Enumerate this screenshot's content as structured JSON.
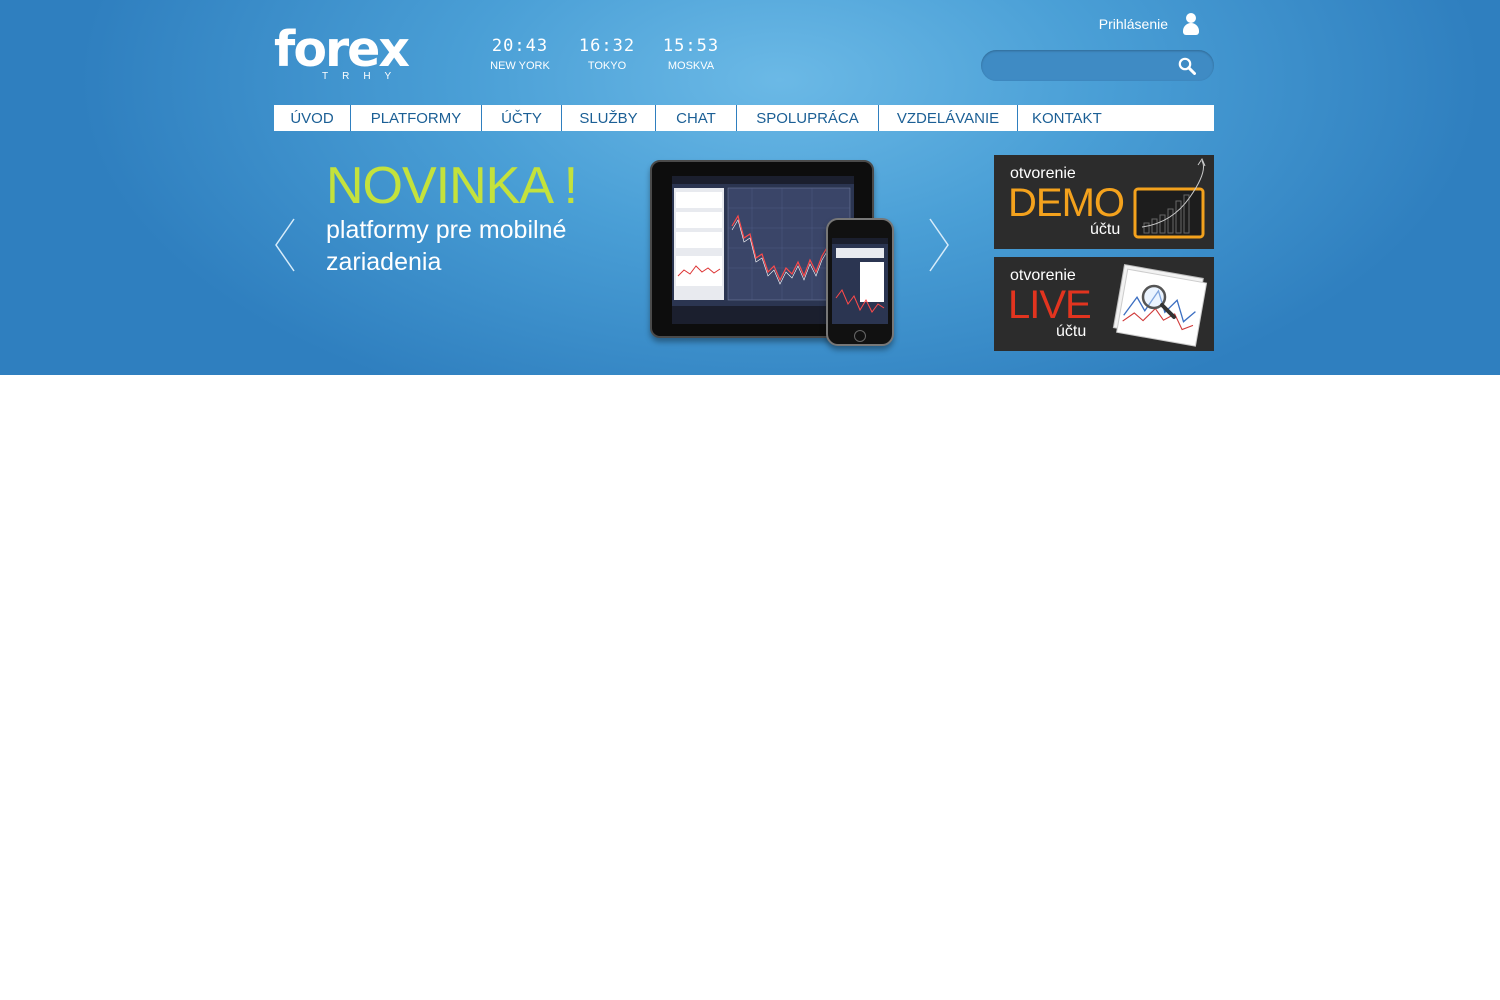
{
  "logo": {
    "word": "forex",
    "sub": "TRHY"
  },
  "clocks": [
    {
      "time": "20:43",
      "city": "NEW YORK"
    },
    {
      "time": "16:32",
      "city": "TOKYO"
    },
    {
      "time": "15:53",
      "city": "MOSKVA"
    }
  ],
  "login": {
    "label": "Prihlásenie",
    "icon": "user-icon"
  },
  "search": {
    "placeholder": "",
    "icon": "search-icon"
  },
  "nav": {
    "items": [
      {
        "label": "ÚVOD"
      },
      {
        "label": "PLATFORMY"
      },
      {
        "label": "ÚČTY"
      },
      {
        "label": "SLUŽBY"
      },
      {
        "label": "CHAT"
      },
      {
        "label": "SPOLUPRÁCA"
      },
      {
        "label": "VZDELÁVANIE"
      },
      {
        "label": "KONTAKT"
      }
    ]
  },
  "slider": {
    "title": "NOVINKA !",
    "text": "platformy pre mobilné zariadenia",
    "prev_icon": "chevron-left-icon",
    "next_icon": "chevron-right-icon"
  },
  "cta": {
    "demo": {
      "pre": "otvorenie",
      "big": "DEMO",
      "post": "účtu",
      "accent": "#f4a21d"
    },
    "live": {
      "pre": "otvorenie",
      "big": "LIVE",
      "post": "účtu",
      "accent": "#e2341f"
    }
  },
  "colors": {
    "header_blue": "#4a9fd6",
    "nav_text": "#1b5f95",
    "title_green": "#c4e23c"
  }
}
